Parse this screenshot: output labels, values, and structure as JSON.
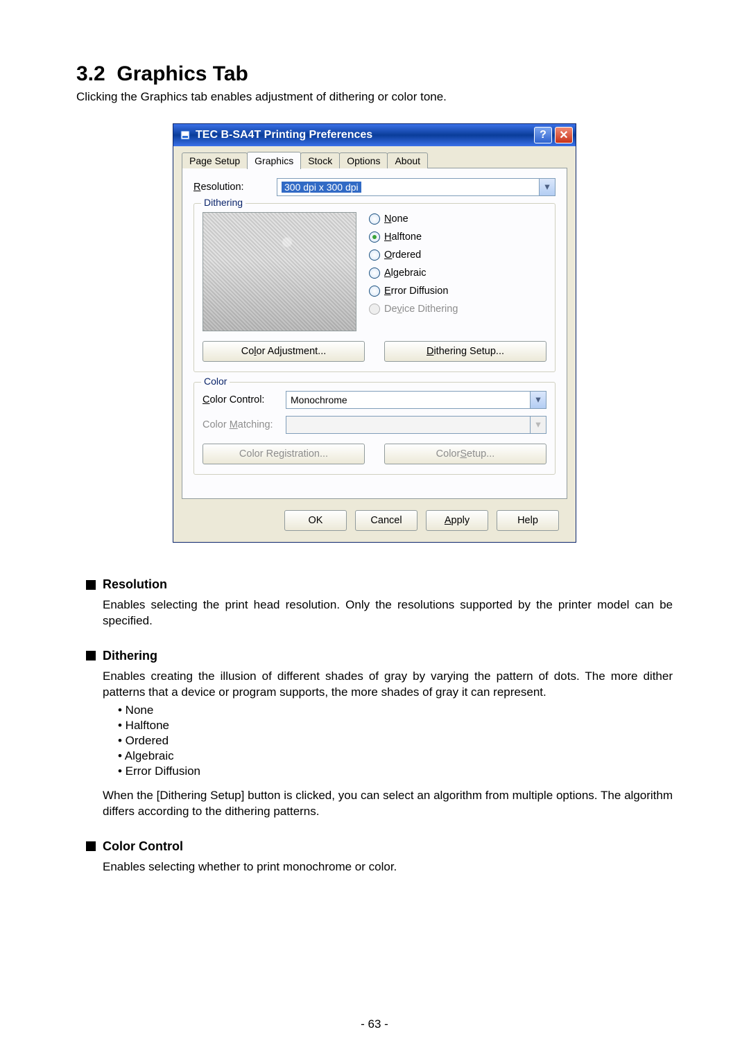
{
  "section": {
    "number": "3.2",
    "title": "Graphics Tab"
  },
  "intro": "Clicking the Graphics tab enables adjustment of dithering or color tone.",
  "dialog": {
    "title": "TEC B-SA4T Printing Preferences",
    "help_glyph": "?",
    "close_glyph": "✕",
    "tabs": [
      "Page Setup",
      "Graphics",
      "Stock",
      "Options",
      "About"
    ],
    "active_tab": "Graphics",
    "resolution": {
      "label": "Resolution:",
      "ukey": "R",
      "value": "300 dpi x 300 dpi"
    },
    "dithering": {
      "legend": "Dithering",
      "options": [
        {
          "label": "None",
          "ukey": "N",
          "selected": false,
          "disabled": false
        },
        {
          "label": "Halftone",
          "ukey": "H",
          "selected": true,
          "disabled": false
        },
        {
          "label": "Ordered",
          "ukey": "O",
          "selected": false,
          "disabled": false
        },
        {
          "label": "Algebraic",
          "ukey": "A",
          "selected": false,
          "disabled": false
        },
        {
          "label": "Error Diffusion",
          "ukey": "E",
          "selected": false,
          "disabled": false
        },
        {
          "label": "Device Dithering",
          "ukey": "v",
          "selected": false,
          "disabled": true
        }
      ],
      "btn_adjust": "Color Adjustment...",
      "btn_adjust_ukey": "l",
      "btn_setup": "Dithering Setup...",
      "btn_setup_ukey": "D"
    },
    "color": {
      "legend": "Color",
      "control_label": "Color Control:",
      "control_ukey": "C",
      "control_value": "Monochrome",
      "matching_label": "Color Matching:",
      "matching_ukey": "M",
      "matching_value": "",
      "btn_reg": "Color Registration...",
      "btn_setup": "Color Setup...",
      "btn_setup_ukey": "S"
    },
    "footer": {
      "ok": "OK",
      "cancel": "Cancel",
      "apply": "Apply",
      "apply_ukey": "A",
      "help": "Help"
    }
  },
  "article": {
    "resolution": {
      "head": "Resolution",
      "body": "Enables selecting the print head resolution.  Only the resolutions supported by the printer model can be specified."
    },
    "dithering": {
      "head": "Dithering",
      "body": "Enables creating the illusion of different shades of gray by varying the pattern of dots.  The more dither patterns that a device or program supports, the more shades of gray it can represent.",
      "bullets": [
        "None",
        "Halftone",
        "Ordered",
        "Algebraic",
        "Error Diffusion"
      ],
      "body2": "When the [Dithering Setup] button is clicked, you can select an algorithm from multiple options.  The algorithm differs according to the dithering patterns."
    },
    "colorcontrol": {
      "head": "Color Control",
      "body": "Enables selecting whether to print monochrome or color."
    }
  },
  "page_number": "- 63 -"
}
